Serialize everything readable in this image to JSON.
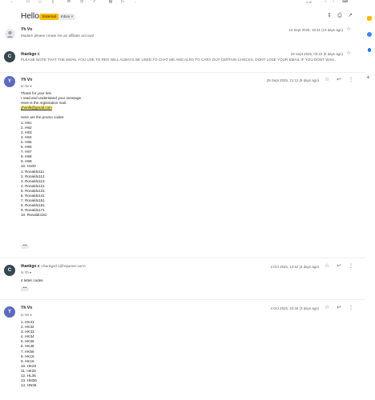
{
  "toolbar": {
    "icons": [
      "back-icon",
      "archive-icon",
      "report-icon",
      "delete-icon",
      "mail-icon",
      "snooze-icon",
      "add-task-icon",
      "move-icon",
      "label-icon",
      "more-icon"
    ],
    "page_count": "1 of",
    "nav": [
      "‹",
      "›"
    ]
  },
  "subject": {
    "title": "Hello",
    "external": "External",
    "inbox": "Inbox ×"
  },
  "messages": [
    {
      "sender": "Yh Vn",
      "snippet": "Madam please create me an affiliate account",
      "date": "24 Sept 2025, 18:31 (13 days ago)"
    },
    {
      "initial": "C",
      "sender": "thankgo c",
      "snippet": "PLEASE NOTE THAT THE EMAIL YOU USE TO REG WILL ALWAYS BE USED TO CHAT ME AND ALSO TO CARY OUT CERTAIN CHECKS. DONT LOSE YOUR EMAIL IF YOU DONT WAN...",
      "date": "29 Sept 2025, 03:22 (8 days ago)"
    },
    {
      "initial": "Y",
      "sender": "Yh Vn",
      "to": "to me ▾",
      "date": "29 Sept 2025, 21:12 (8 days ago)",
      "intro": [
        "Thank for your link.",
        "I read and understand your message.",
        "Here is the registration mail."
      ],
      "email": "yhnnlk@gmail.com",
      "codes_heading": "Here are the promo codes",
      "codes": [
        "1. H91",
        "2. H92",
        "3. H93",
        "4. H94",
        "5. H95",
        "6. H96",
        "7. H97",
        "8. H98",
        "9. H99",
        "10. H100",
        "1. Ronaldo111",
        "2. Ronaldo112",
        "3. Ronaldo113",
        "4. Ronaldo121",
        "5. Ronaldo131",
        "6. Ronaldo141",
        "7. Ronaldo151",
        "8. Ronaldo161",
        "9. Ronaldo171",
        "10. Ronaldo181"
      ],
      "more": "•••"
    },
    {
      "initial": "C",
      "sender": "thankgo c",
      "address": "<thankgod.c@hspartner.com>",
      "to": "to Yh ▾",
      "date": "3 Oct 2025, 12:52 (4 days ago)",
      "text": "4 letter codes",
      "more": "•••"
    },
    {
      "initial": "Y",
      "sender": "Yh Vn",
      "to": "to me ▾",
      "date": "4 Oct 2025, 22:34 (3 days ago)",
      "codes": [
        "1. HK31",
        "2. HK32",
        "3. HK33",
        "4. HK34",
        "5. HK35",
        "6. HK46",
        "7. HK56",
        "8. HK15",
        "9. HK16",
        "10. HK20",
        "11. HK25",
        "12. HL36",
        "13. HM36",
        "14. HN36"
      ]
    }
  ],
  "colors": {
    "avatar_c": "#37474f",
    "avatar_y": "#5c6bc0",
    "external_badge": "#fbbc04",
    "highlight": "#fbf27c"
  }
}
